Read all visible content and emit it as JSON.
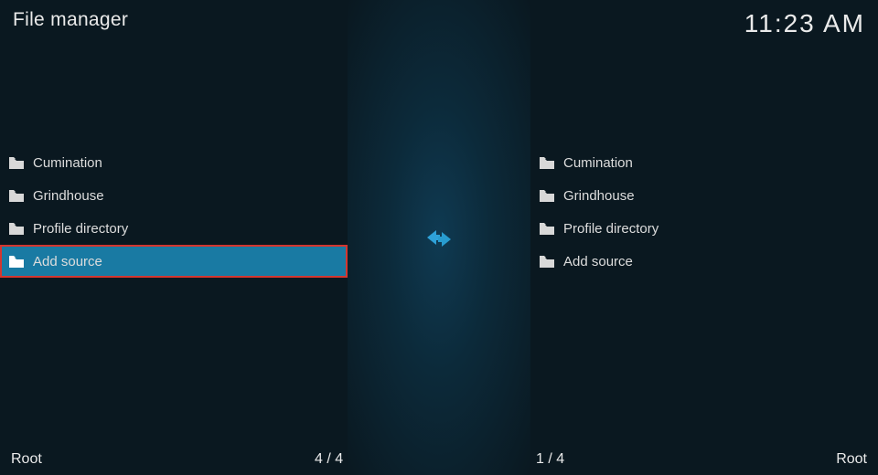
{
  "header": {
    "title": "File manager",
    "clock": "11:23 AM"
  },
  "panes": {
    "left": {
      "items": [
        {
          "label": "Cumination"
        },
        {
          "label": "Grindhouse"
        },
        {
          "label": "Profile directory"
        },
        {
          "label": "Add source"
        }
      ],
      "selected_index": 3
    },
    "right": {
      "items": [
        {
          "label": "Cumination"
        },
        {
          "label": "Grindhouse"
        },
        {
          "label": "Profile directory"
        },
        {
          "label": "Add source"
        }
      ]
    }
  },
  "footer": {
    "left_label": "Root",
    "left_count": "4 / 4",
    "right_count": "1 / 4",
    "right_label": "Root"
  }
}
